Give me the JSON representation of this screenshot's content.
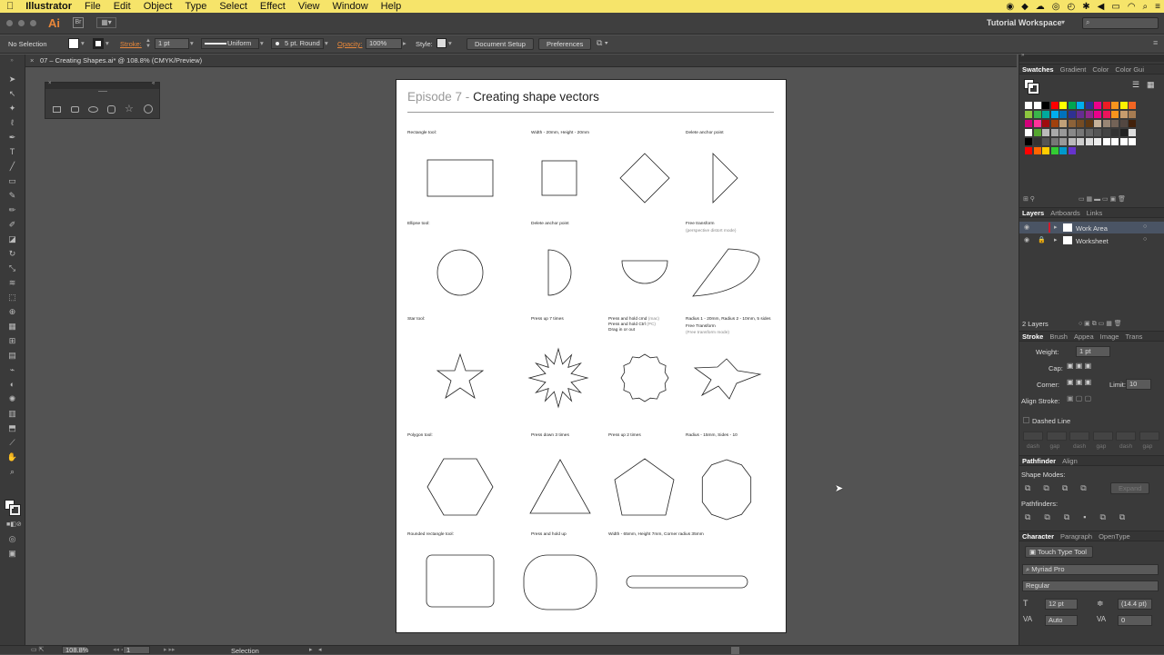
{
  "menubar": {
    "app": "Illustrator",
    "items": [
      "File",
      "Edit",
      "Object",
      "Type",
      "Select",
      "Effect",
      "View",
      "Window",
      "Help"
    ]
  },
  "appbar": {
    "logo": "Ai",
    "workspace": "Tutorial Workspace",
    "search_placeholder": ""
  },
  "control": {
    "selection": "No Selection",
    "stroke_label": "Stroke:",
    "stroke_value": "1 pt",
    "profile": "Uniform",
    "brush": "5 pt. Round",
    "opacity_label": "Opacity:",
    "opacity_value": "100%",
    "style_label": "Style:",
    "doc_setup": "Document Setup",
    "preferences": "Preferences"
  },
  "doc": {
    "tab_title": "07 – Creating Shapes.ai* @ 108.8% (CMYK/Preview)"
  },
  "artboard": {
    "title_prefix": "Episode 7 -",
    "title_main": "Creating shape vectors",
    "labels": {
      "rect": "Rectangle tool:",
      "rect_wh": "Width - 20mm, Height - 20mm",
      "del1": "Delete anchor point",
      "ellipse": "Ellipse tool:",
      "del2": "Delete anchor point",
      "free": "Free transform",
      "free_sub": "(perspective distort mode)",
      "star": "Star tool:",
      "up7": "Press up 7 times",
      "cmd1": "Press and hold cmd",
      "cmd1_sub": "(mac)",
      "cmd2": "Press and hold Ctrl",
      "cmd2_sub": "(PC)",
      "cmd3": "Drag in or out",
      "radius": "Radius 1 - 20mm, Radius 2 - 10mm, 5 sides",
      "free2": "Free Transform",
      "free2_sub": "(Free transform mode)",
      "polygon": "Polygon tool:",
      "down3": "Press down 3 times",
      "up2": "Press up 2 times",
      "radius2": "Radius - 15mm, Sides - 10",
      "rounded": "Rounded rectangle tool:",
      "hold": "Press and hold up",
      "wh2": "Width - 65mm, Height 7mm, Corner radius 35mm"
    }
  },
  "panels": {
    "swatches_tabs": [
      "Swatches",
      "Gradient",
      "Color",
      "Color Gui"
    ],
    "layers_tabs": [
      "Layers",
      "Artboards",
      "Links"
    ],
    "layers": [
      {
        "name": "Work Area",
        "color": "#d11b2c"
      },
      {
        "name": "Worksheet",
        "color": "#3a3a3a"
      }
    ],
    "layers_count": "2 Layers",
    "stroke_tabs": [
      "Stroke",
      "Brush",
      "Appea",
      "Image",
      "Trans"
    ],
    "weight_label": "Weight:",
    "weight_value": "1 pt",
    "cap_label": "Cap:",
    "corner_label": "Corner:",
    "limit_label": "Limit:",
    "limit_value": "10",
    "align_label": "Align Stroke:",
    "dashed": "Dashed Line",
    "dash_labels": [
      "dash",
      "gap",
      "dash",
      "gap",
      "dash",
      "gap"
    ],
    "pathfinder_tabs": [
      "Pathfinder",
      "Align"
    ],
    "shape_modes": "Shape Modes:",
    "expand": "Expand",
    "pathfinders": "Pathfinders:",
    "char_tabs": [
      "Character",
      "Paragraph",
      "OpenType"
    ],
    "touch": "Touch Type Tool",
    "font": "Myriad Pro",
    "style": "Regular",
    "size": "12 pt",
    "leading": "(14.4 pt)",
    "kerning": "Auto",
    "tracking": "0"
  },
  "status": {
    "zoom": "108.8%",
    "page": "1",
    "mode": "Selection"
  },
  "colors": {
    "menubar": "#f6e46a",
    "accent": "#e8873a"
  }
}
